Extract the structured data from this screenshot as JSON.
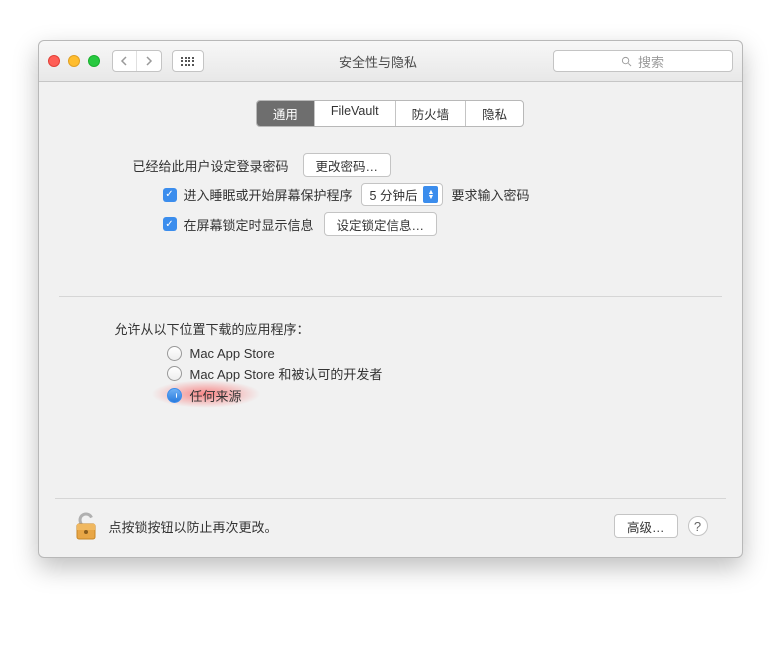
{
  "window": {
    "title": "安全性与隐私"
  },
  "search": {
    "placeholder": "搜索"
  },
  "tabs": [
    "通用",
    "FileVault",
    "防火墙",
    "隐私"
  ],
  "active_tab": 0,
  "section1": {
    "password_set_label": "已经给此用户设定登录密码",
    "change_password_btn": "更改密码…",
    "sleep_checkbox_label": "进入睡眠或开始屏幕保护程序",
    "sleep_select_value": "5 分钟后",
    "sleep_suffix": "要求输入密码",
    "lock_msg_checkbox_label": "在屏幕锁定时显示信息",
    "lock_msg_btn": "设定锁定信息…"
  },
  "section2": {
    "allow_label": "允许从以下位置下载的应用程序：",
    "radios": [
      "Mac App Store",
      "Mac App Store 和被认可的开发者",
      "任何来源"
    ],
    "selected": 2
  },
  "bottom": {
    "lock_text": "点按锁按钮以防止再次更改。",
    "advanced_btn": "高级…"
  }
}
